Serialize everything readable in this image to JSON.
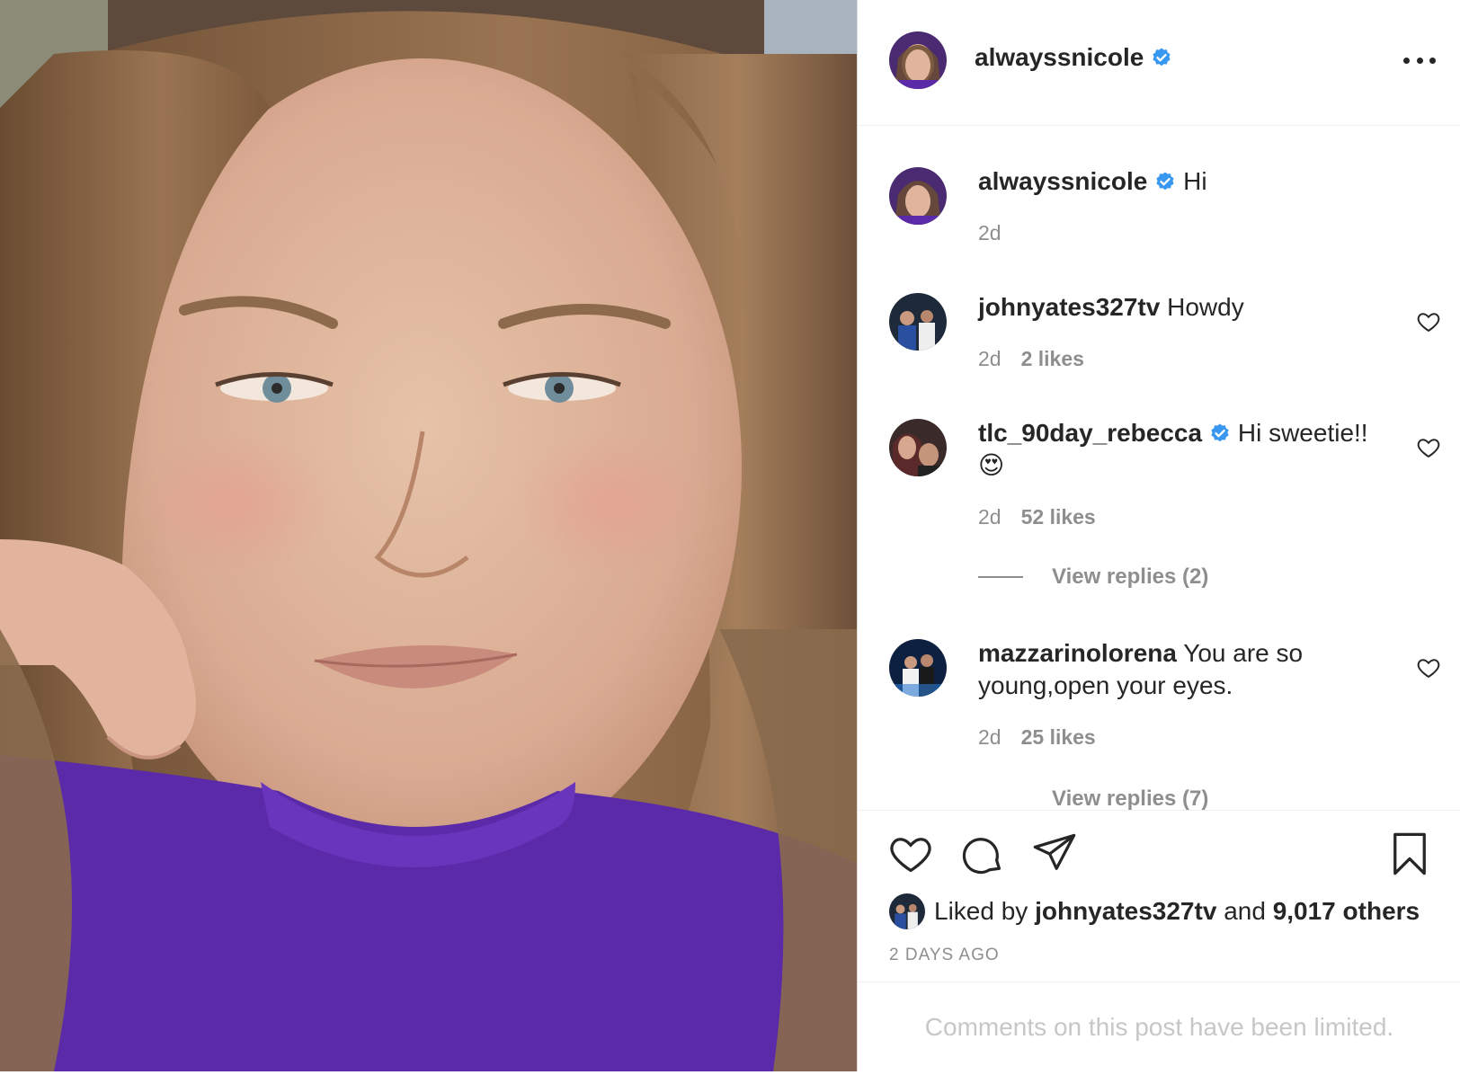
{
  "post": {
    "author": "alwayssnicole",
    "verified": true,
    "more_icon": "more-horizontal-icon",
    "photo_description_icon": "selfie-photo"
  },
  "comments": [
    {
      "username": "alwayssnicole",
      "verified": true,
      "text": "Hi",
      "age": "2d",
      "likes": ""
    },
    {
      "username": "johnyates327tv",
      "verified": false,
      "text": "Howdy",
      "age": "2d",
      "likes": "2 likes"
    },
    {
      "username": "tlc_90day_rebecca",
      "verified": true,
      "text": "Hi sweetie!!",
      "emoji": "😍",
      "age": "2d",
      "likes": "52 likes",
      "view_replies": "View replies (2)"
    },
    {
      "username": "mazzarinolorena",
      "verified": false,
      "text": "You are so young,open your eyes.",
      "age": "2d",
      "likes": "25 likes",
      "view_replies": "View replies (7)"
    }
  ],
  "actions": {
    "like_icon": "heart-icon",
    "comment_icon": "comment-icon",
    "share_icon": "paper-plane-icon",
    "save_icon": "bookmark-icon"
  },
  "liked_by": {
    "prefix": "Liked by",
    "user": "johnyates327tv",
    "middle": "and",
    "others": "9,017 others"
  },
  "timestamp": "2 DAYS AGO",
  "comments_limited": "Comments on this post have been limited.",
  "colors": {
    "verified_blue": "#3897f0",
    "text": "#262626",
    "muted": "#8e8e8e",
    "shirt_purple": "#5b2aa8"
  }
}
